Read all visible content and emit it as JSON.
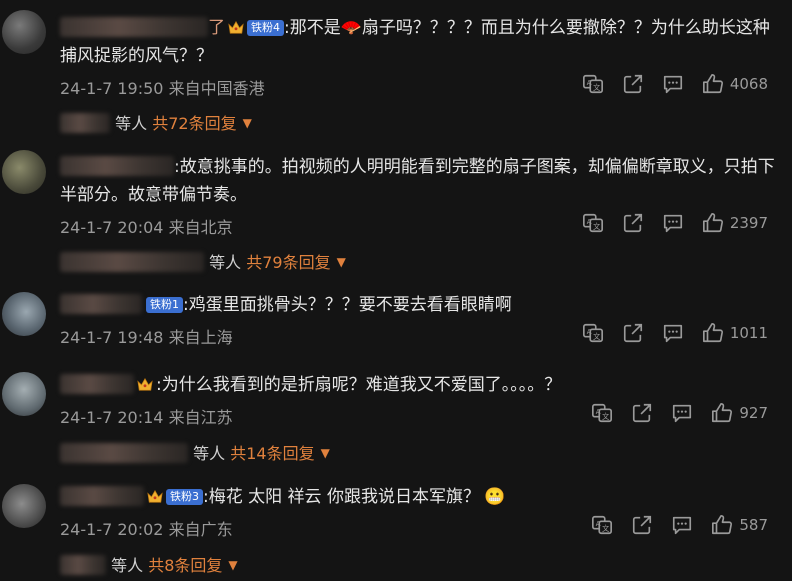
{
  "comments": [
    {
      "user_tail": "了",
      "badge": "铁粉4",
      "text_a": ":那不是",
      "text_b": "扇子吗？？？？而且为什么要撤除？？为什么助长这种",
      "text_c": "捕风捉影的风气？？",
      "date": "24-1-7 19:50",
      "source": "来自中国香港",
      "likes": "4068",
      "replies_prefix": "等人",
      "replies_count": "共72条回复"
    },
    {
      "user_tail": "",
      "badge": "",
      "text_a": ":故意挑事的。拍视频的人明明能看到完整的扇子图案，却偏偏断章取义，只拍下",
      "text_c": "半部分。故意带偏节奏。",
      "date": "24-1-7 20:04",
      "source": "来自北京",
      "likes": "2397",
      "replies_prefix": "等人",
      "replies_count": "共79条回复"
    },
    {
      "badge": "铁粉1",
      "text_a": ":鸡蛋里面挑骨头？？？要不要去看看眼睛啊",
      "date": "24-1-7 19:48",
      "source": "来自上海",
      "likes": "1011"
    },
    {
      "text_a": ":为什么我看到的是折扇呢？难道我又不爱国了。。。。？",
      "date": "24-1-7 20:14",
      "source": "来自江苏",
      "likes": "927",
      "replies_prefix": "等人",
      "replies_count": "共14条回复"
    },
    {
      "badge": "铁粉3",
      "text_a": ":梅花 太阳 祥云 你跟我说日本军旗？",
      "date": "24-1-7 20:02",
      "source": "来自广东",
      "likes": "587",
      "replies_prefix": "等人",
      "replies_count": "共8条回复"
    }
  ],
  "icons": [
    "translate-icon",
    "share-icon",
    "comment-icon",
    "like-icon",
    "crown-icon",
    "fan-icon",
    "grimace-emoji"
  ]
}
